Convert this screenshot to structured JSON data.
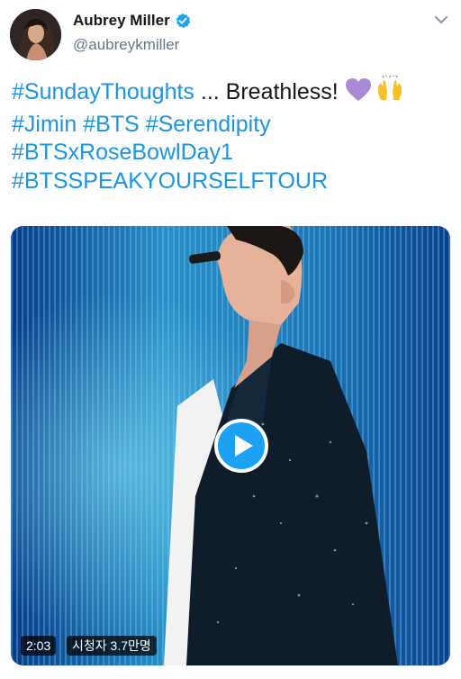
{
  "user": {
    "display_name": "Aubrey Miller",
    "handle": "@aubreykmiller",
    "verified_icon": "verified-badge-icon",
    "avatar_icon": "profile-avatar"
  },
  "menu_icon": "chevron-down-icon",
  "tweet": {
    "hashtag_1": "#SundayThoughts",
    "text_1": " ... Breathless! ",
    "emoji_1": "purple-heart-icon",
    "emoji_2": "raising-hands-icon",
    "hashtag_2": "#Jimin",
    "hashtag_3": "#BTS",
    "hashtag_4": "#Serendipity",
    "hashtag_5": "#BTSxRoseBowlDay1",
    "hashtag_6": "#BTSSPEAKYOURSELFTOUR"
  },
  "video": {
    "duration": "2:03",
    "views": "시청자 3.7만명",
    "play_icon": "play-icon"
  },
  "colors": {
    "link": "#1b95e0",
    "text": "#14171a",
    "secondary": "#657786",
    "play_button": "#1da1f2",
    "verified": "#1da1f2"
  }
}
